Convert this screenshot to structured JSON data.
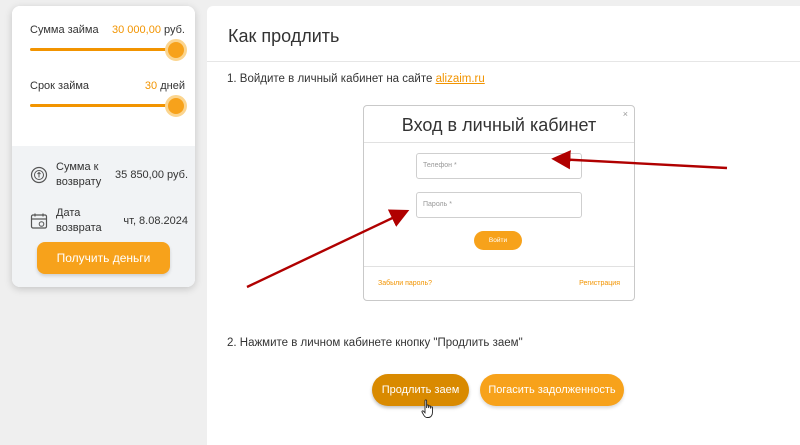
{
  "calculator": {
    "amount": {
      "label": "Сумма займа",
      "value": "30 000,00",
      "unit": "руб.",
      "level_percent": 100
    },
    "term": {
      "label": "Срок займа",
      "value": "30",
      "unit": "дней",
      "level_percent": 100
    },
    "return_sum": {
      "label": "Сумма к возврату",
      "value": "35 850,00 руб."
    },
    "return_date": {
      "label": "Дата возврата",
      "value": "чт, 8.08.2024"
    },
    "get_money_label": "Получить деньги"
  },
  "main": {
    "title": "Как продлить",
    "step1_text": "1. Войдите в личный кабинет на сайте ",
    "step1_link": "alizaim.ru",
    "step2_text": "2. Нажмите в личном кабинете кнопку \"Продлить заем\"",
    "login_shot": {
      "title": "Вход в личный кабинет",
      "close": "×",
      "phone_placeholder": "Телефон *",
      "password_placeholder": "Пароль *",
      "login_button": "Войти",
      "forgot_link": "Забыли пароль?",
      "register_link": "Регистрация"
    },
    "extend_button": "Продлить заем",
    "repay_button": "Погасить задолженность"
  },
  "colors": {
    "accent": "#f7a21b",
    "accent_dark": "#d98a00",
    "arrow": "#b00000",
    "background": "#efefef"
  },
  "icons": {
    "return_sum": "coin-return-icon",
    "return_date": "calendar-icon",
    "cursor": "hand-cursor-icon"
  }
}
